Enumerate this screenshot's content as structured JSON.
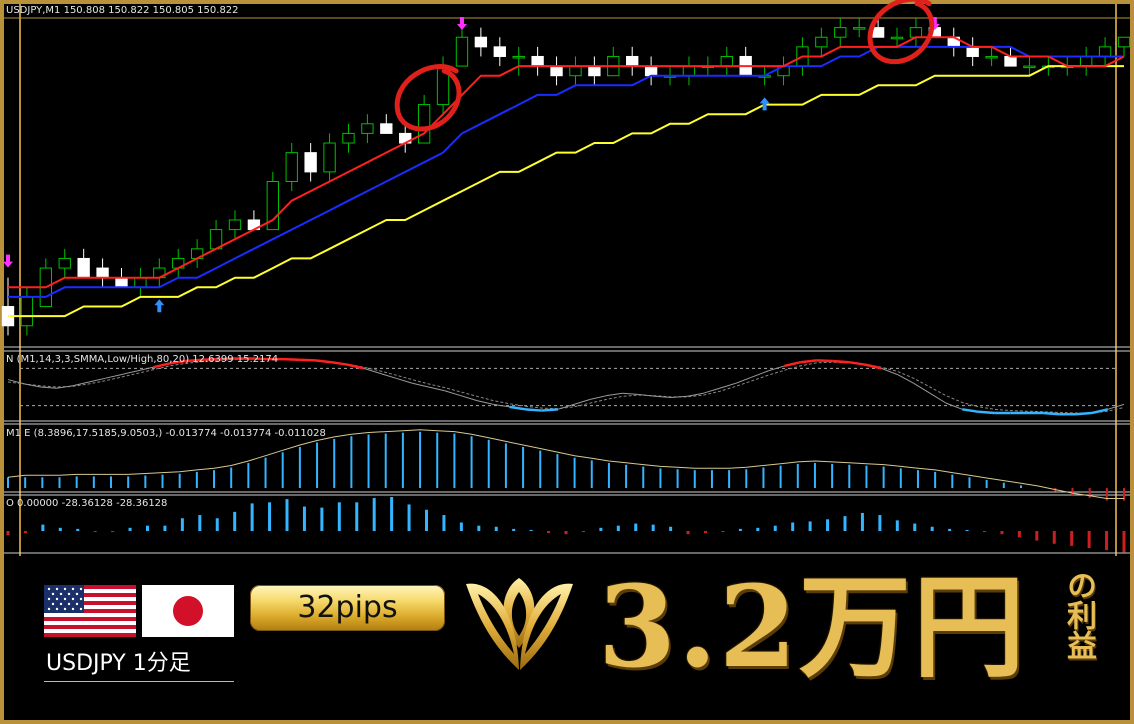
{
  "header": {
    "symbol_info": "USDJPY,M1  150.808 150.822 150.805 150.822",
    "panel1_info": "N (M1,14,3,3,SMMA,Low/High,80,20) 12.6399 15.2174",
    "panel2_info": "M1 E (8.3896,17.5185,9.0503,) -0.013774 -0.013774 -0.011028",
    "panel3_info": "O 0.00000 -28.36128 -28.36128"
  },
  "banner": {
    "pair_label": "USDJPY 1分足",
    "pips": "32pips",
    "profit_amount": "3.2万円",
    "profit_suffix": "の利益",
    "flags": [
      "us-flag",
      "japan-flag"
    ]
  },
  "colors": {
    "frame": "#b8913a",
    "bull_candle": "#00c000",
    "bear_candle": "#ffffff",
    "ma_fast": "#ff2020",
    "ma_mid": "#1a2cff",
    "ma_slow": "#ffff30",
    "buy_arrow": "#2f8fff",
    "sell_arrow": "#ff30ff",
    "highlight_circle": "#e0201a",
    "histogram_pos": "#33b5ff",
    "histogram_neg": "#cc2020",
    "gold_text": "#e7be55"
  },
  "chart_data": [
    {
      "type": "candlestick",
      "title": "USDJPY,M1",
      "series_names": [
        "price",
        "ma_fast",
        "ma_mid",
        "ma_slow"
      ],
      "ylim": [
        150.5,
        150.84
      ],
      "candles": [
        [
          150.54,
          150.57,
          150.51,
          150.52
        ],
        [
          150.52,
          150.56,
          150.51,
          150.55
        ],
        [
          150.54,
          150.59,
          150.54,
          150.58
        ],
        [
          150.58,
          150.6,
          150.57,
          150.59
        ],
        [
          150.59,
          150.6,
          150.57,
          150.57
        ],
        [
          150.58,
          150.59,
          150.56,
          150.57
        ],
        [
          150.57,
          150.58,
          150.56,
          150.56
        ],
        [
          150.56,
          150.58,
          150.55,
          150.57
        ],
        [
          150.57,
          150.59,
          150.56,
          150.58
        ],
        [
          150.58,
          150.6,
          150.57,
          150.59
        ],
        [
          150.59,
          150.61,
          150.58,
          150.6
        ],
        [
          150.6,
          150.63,
          150.6,
          150.62
        ],
        [
          150.62,
          150.64,
          150.61,
          150.63
        ],
        [
          150.63,
          150.64,
          150.62,
          150.62
        ],
        [
          150.62,
          150.68,
          150.62,
          150.67
        ],
        [
          150.67,
          150.71,
          150.66,
          150.7
        ],
        [
          150.7,
          150.71,
          150.67,
          150.68
        ],
        [
          150.68,
          150.72,
          150.67,
          150.71
        ],
        [
          150.71,
          150.73,
          150.7,
          150.72
        ],
        [
          150.72,
          150.74,
          150.71,
          150.73
        ],
        [
          150.73,
          150.74,
          150.72,
          150.72
        ],
        [
          150.72,
          150.73,
          150.7,
          150.71
        ],
        [
          150.71,
          150.76,
          150.71,
          150.75
        ],
        [
          150.75,
          150.8,
          150.74,
          150.79
        ],
        [
          150.79,
          150.83,
          150.79,
          150.82
        ],
        [
          150.82,
          150.83,
          150.8,
          150.81
        ],
        [
          150.81,
          150.82,
          150.79,
          150.8
        ],
        [
          150.8,
          150.81,
          150.78,
          150.8
        ],
        [
          150.8,
          150.81,
          150.78,
          150.79
        ],
        [
          150.79,
          150.8,
          150.77,
          150.78
        ],
        [
          150.78,
          150.8,
          150.77,
          150.79
        ],
        [
          150.79,
          150.8,
          150.77,
          150.78
        ],
        [
          150.78,
          150.81,
          150.78,
          150.8
        ],
        [
          150.8,
          150.81,
          150.78,
          150.79
        ],
        [
          150.79,
          150.8,
          150.77,
          150.78
        ],
        [
          150.78,
          150.79,
          150.77,
          150.78
        ],
        [
          150.78,
          150.8,
          150.77,
          150.79
        ],
        [
          150.79,
          150.8,
          150.78,
          150.79
        ],
        [
          150.79,
          150.81,
          150.78,
          150.8
        ],
        [
          150.8,
          150.81,
          150.78,
          150.78
        ],
        [
          150.78,
          150.79,
          150.77,
          150.78
        ],
        [
          150.78,
          150.8,
          150.77,
          150.79
        ],
        [
          150.79,
          150.82,
          150.78,
          150.81
        ],
        [
          150.81,
          150.83,
          150.8,
          150.82
        ],
        [
          150.82,
          150.84,
          150.81,
          150.83
        ],
        [
          150.83,
          150.84,
          150.82,
          150.83
        ],
        [
          150.83,
          150.84,
          150.82,
          150.82
        ],
        [
          150.82,
          150.83,
          150.81,
          150.82
        ],
        [
          150.82,
          150.84,
          150.81,
          150.83
        ],
        [
          150.83,
          150.84,
          150.82,
          150.82
        ],
        [
          150.82,
          150.83,
          150.8,
          150.81
        ],
        [
          150.81,
          150.82,
          150.79,
          150.8
        ],
        [
          150.8,
          150.81,
          150.79,
          150.8
        ],
        [
          150.8,
          150.81,
          150.79,
          150.79
        ],
        [
          150.79,
          150.8,
          150.78,
          150.79
        ],
        [
          150.79,
          150.8,
          150.78,
          150.79
        ],
        [
          150.79,
          150.8,
          150.78,
          150.79
        ],
        [
          150.79,
          150.81,
          150.78,
          150.8
        ],
        [
          150.8,
          150.82,
          150.79,
          150.81
        ],
        [
          150.81,
          150.82,
          150.8,
          150.82
        ]
      ],
      "ma_fast": [
        150.56,
        150.56,
        150.56,
        150.57,
        150.57,
        150.57,
        150.57,
        150.57,
        150.57,
        150.58,
        150.59,
        150.6,
        150.61,
        150.62,
        150.63,
        150.65,
        150.66,
        150.67,
        150.68,
        150.69,
        150.7,
        150.71,
        150.72,
        150.74,
        150.76,
        150.78,
        150.78,
        150.79,
        150.79,
        150.79,
        150.79,
        150.79,
        150.79,
        150.79,
        150.79,
        150.79,
        150.79,
        150.79,
        150.79,
        150.79,
        150.79,
        150.79,
        150.8,
        150.8,
        150.81,
        150.81,
        150.81,
        150.81,
        150.82,
        150.82,
        150.82,
        150.81,
        150.81,
        150.8,
        150.8,
        150.8,
        150.79,
        150.79,
        150.79,
        150.8
      ],
      "ma_mid": [
        150.55,
        150.55,
        150.55,
        150.56,
        150.56,
        150.56,
        150.56,
        150.56,
        150.56,
        150.57,
        150.57,
        150.58,
        150.59,
        150.6,
        150.61,
        150.62,
        150.63,
        150.64,
        150.65,
        150.66,
        150.67,
        150.68,
        150.69,
        150.7,
        150.72,
        150.73,
        150.74,
        150.75,
        150.76,
        150.76,
        150.77,
        150.77,
        150.77,
        150.77,
        150.78,
        150.78,
        150.78,
        150.78,
        150.78,
        150.78,
        150.78,
        150.79,
        150.79,
        150.79,
        150.8,
        150.8,
        150.81,
        150.81,
        150.81,
        150.81,
        150.81,
        150.81,
        150.81,
        150.81,
        150.8,
        150.8,
        150.8,
        150.8,
        150.8,
        150.8
      ],
      "ma_slow": [
        150.53,
        150.53,
        150.53,
        150.53,
        150.54,
        150.54,
        150.54,
        150.55,
        150.55,
        150.55,
        150.56,
        150.56,
        150.57,
        150.57,
        150.58,
        150.59,
        150.59,
        150.6,
        150.61,
        150.62,
        150.63,
        150.63,
        150.64,
        150.65,
        150.66,
        150.67,
        150.68,
        150.68,
        150.69,
        150.7,
        150.7,
        150.71,
        150.71,
        150.72,
        150.72,
        150.73,
        150.73,
        150.74,
        150.74,
        150.74,
        150.75,
        150.75,
        150.75,
        150.76,
        150.76,
        150.76,
        150.77,
        150.77,
        150.77,
        150.78,
        150.78,
        150.78,
        150.78,
        150.78,
        150.78,
        150.79,
        150.79,
        150.79,
        150.79,
        150.79
      ],
      "buy_arrows": [
        8,
        40
      ],
      "sell_arrows": [
        0,
        24,
        49
      ],
      "highlight_circles": [
        22,
        47
      ]
    },
    {
      "type": "line",
      "title": "N (M1,14,3,3,SMMA,Low/High,80,20)",
      "ylim": [
        0,
        100
      ],
      "levels": [
        80,
        20
      ],
      "series": [
        {
          "name": "main",
          "values": [
            62,
            55,
            50,
            48,
            52,
            58,
            64,
            70,
            76,
            82,
            88,
            92,
            94,
            95,
            96,
            96,
            95,
            95,
            94,
            93,
            90,
            86,
            80,
            72,
            64,
            56,
            50,
            44,
            36,
            28,
            22,
            18,
            14,
            12,
            14,
            22,
            30,
            36,
            40,
            38,
            35,
            33,
            35,
            40,
            48,
            56,
            66,
            76,
            84,
            90,
            93,
            92,
            90,
            86,
            80,
            70,
            56,
            40,
            24,
            14,
            10,
            8,
            8,
            8,
            8,
            6,
            6,
            8,
            14,
            22
          ]
        },
        {
          "name": "signal",
          "values": [
            58,
            55,
            52,
            50,
            51,
            55,
            60,
            66,
            72,
            78,
            84,
            88,
            91,
            93,
            94,
            95,
            95,
            94,
            93,
            92,
            90,
            87,
            82,
            76,
            69,
            62,
            55,
            49,
            42,
            35,
            28,
            23,
            19,
            16,
            15,
            18,
            24,
            30,
            35,
            37,
            36,
            34,
            34,
            37,
            43,
            51,
            60,
            69,
            77,
            84,
            89,
            90,
            89,
            87,
            82,
            75,
            64,
            50,
            36,
            25,
            18,
            14,
            12,
            11,
            10,
            9,
            8,
            8,
            11,
            17
          ]
        }
      ]
    },
    {
      "type": "bar",
      "title": "M1 E (8.3896,17.5185,9.0503,)",
      "values": [
        0.012,
        0.012,
        0.012,
        0.012,
        0.013,
        0.013,
        0.013,
        0.013,
        0.014,
        0.015,
        0.016,
        0.018,
        0.02,
        0.023,
        0.028,
        0.034,
        0.04,
        0.046,
        0.051,
        0.055,
        0.058,
        0.06,
        0.061,
        0.062,
        0.063,
        0.062,
        0.061,
        0.058,
        0.054,
        0.05,
        0.046,
        0.042,
        0.038,
        0.034,
        0.031,
        0.028,
        0.026,
        0.024,
        0.022,
        0.021,
        0.02,
        0.02,
        0.02,
        0.021,
        0.023,
        0.025,
        0.027,
        0.028,
        0.027,
        0.026,
        0.025,
        0.024,
        0.022,
        0.02,
        0.018,
        0.015,
        0.012,
        0.009,
        0.006,
        0.003,
        0.0,
        -0.004,
        -0.008,
        -0.011,
        -0.014,
        -0.014
      ]
    },
    {
      "type": "bar",
      "title": "O",
      "values": [
        -4,
        -2,
        6,
        3,
        2,
        -1,
        -1,
        3,
        5,
        5,
        12,
        15,
        12,
        18,
        26,
        27,
        30,
        23,
        22,
        27,
        27,
        31,
        32,
        25,
        20,
        15,
        8,
        5,
        4,
        2,
        1,
        -2,
        -3,
        -1,
        3,
        5,
        7,
        6,
        4,
        -3,
        -2,
        -1,
        2,
        3,
        5,
        8,
        9,
        11,
        14,
        17,
        15,
        10,
        7,
        4,
        2,
        1,
        -1,
        -3,
        -6,
        -9,
        -12,
        -14,
        -16,
        -18,
        -20
      ]
    }
  ]
}
